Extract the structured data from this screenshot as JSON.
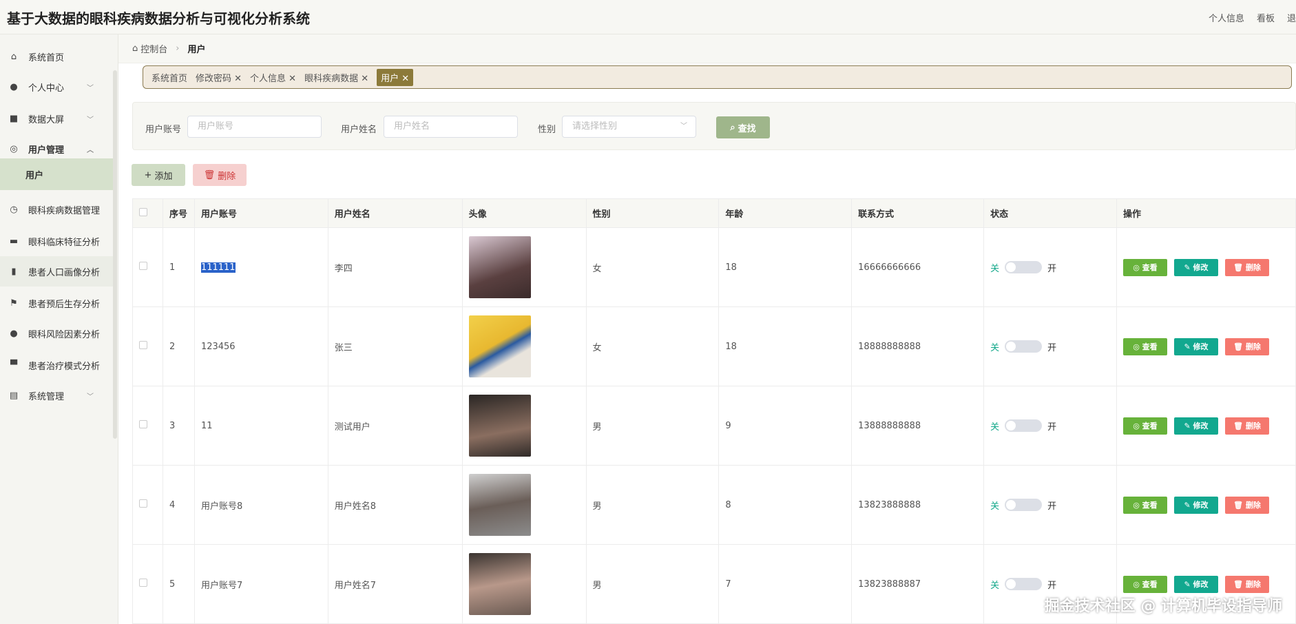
{
  "header": {
    "title": "基于大数据的眼科疾病数据分析与可视化分析系统",
    "links": [
      "个人信息",
      "看板",
      "退"
    ]
  },
  "sidebar": {
    "items": [
      {
        "label": "系统首页",
        "icon": "home-icon",
        "glyph": "⌂"
      },
      {
        "label": "个人中心",
        "icon": "user-icon",
        "glyph": "●",
        "chevron": "﹀"
      },
      {
        "label": "数据大屏",
        "icon": "briefcase-icon",
        "glyph": "■",
        "chevron": "﹀"
      },
      {
        "label": "用户管理",
        "icon": "lifebuoy-icon",
        "glyph": "◎",
        "chevron": "︿"
      },
      {
        "label": "用户"
      },
      {
        "label": "眼科疾病数据管理",
        "icon": "gauge-icon",
        "glyph": "◷"
      },
      {
        "label": "眼科临床特征分析",
        "icon": "chat-icon",
        "glyph": "▬"
      },
      {
        "label": "患者人口画像分析",
        "icon": "chart-icon",
        "glyph": "▮"
      },
      {
        "label": "患者预后生存分析",
        "icon": "flag-icon",
        "glyph": "⚑"
      },
      {
        "label": "眼科风险因素分析",
        "icon": "person-icon",
        "glyph": "●"
      },
      {
        "label": "患者治疗模式分析",
        "icon": "printer-icon",
        "glyph": "▀"
      },
      {
        "label": "系统管理",
        "icon": "clipboard-icon",
        "glyph": "▤",
        "chevron": "﹀"
      }
    ]
  },
  "breadcrumb": {
    "home": "控制台",
    "current": "用户"
  },
  "tags": [
    "系统首页",
    "修改密码 ✕",
    "个人信息 ✕",
    "眼科疾病数据 ✕",
    "用户 ✕"
  ],
  "search": {
    "account_label": "用户账号",
    "account_placeholder": "用户账号",
    "name_label": "用户姓名",
    "name_placeholder": "用户姓名",
    "gender_label": "性别",
    "gender_placeholder": "请选择性别",
    "find": "查找"
  },
  "actions": {
    "add": "添加",
    "delete": "删除"
  },
  "table": {
    "headers": [
      "",
      "序号",
      "用户账号",
      "用户姓名",
      "头像",
      "性别",
      "年龄",
      "联系方式",
      "状态",
      "操作"
    ],
    "rows": [
      {
        "no": "1",
        "account": "111111",
        "name": "李四",
        "gender": "女",
        "age": "18",
        "phone": "16666666666",
        "avatar": "linear-gradient(160deg,#d9c8d2,#5a4040 60%,#3b2b2b)"
      },
      {
        "no": "2",
        "account": "123456",
        "name": "张三",
        "gender": "女",
        "age": "18",
        "phone": "18888888888",
        "avatar": "linear-gradient(150deg,#f2d04a,#e8b830 45%,#2a5aa0 55%,#e9e4dc 70%)"
      },
      {
        "no": "3",
        "account": "11",
        "name": "测试用户",
        "gender": "男",
        "age": "9",
        "phone": "13888888888",
        "avatar": "linear-gradient(170deg,#2a2624,#8a6e60 60%,#2f2a28)"
      },
      {
        "no": "4",
        "account": "用户账号8",
        "name": "用户姓名8",
        "gender": "男",
        "age": "8",
        "phone": "13823888888",
        "avatar": "linear-gradient(170deg,#cfcfcf,#6a5e58 50%,#8c8c8c)"
      },
      {
        "no": "5",
        "account": "用户账号7",
        "name": "用户姓名7",
        "gender": "男",
        "age": "7",
        "phone": "13823888887",
        "avatar": "linear-gradient(170deg,#3a3430,#b8988a 50%,#6a5a52)"
      }
    ],
    "switch_off": "关",
    "switch_on": "开",
    "view": "◎ 查看",
    "edit": "✎ 修改",
    "remove": "🗑 删除"
  },
  "colors": {
    "view": "#67b23a",
    "edit": "#12a88f",
    "remove": "#f5786e"
  },
  "watermark": "掘金技术社区 @ 计算机毕设指导师"
}
